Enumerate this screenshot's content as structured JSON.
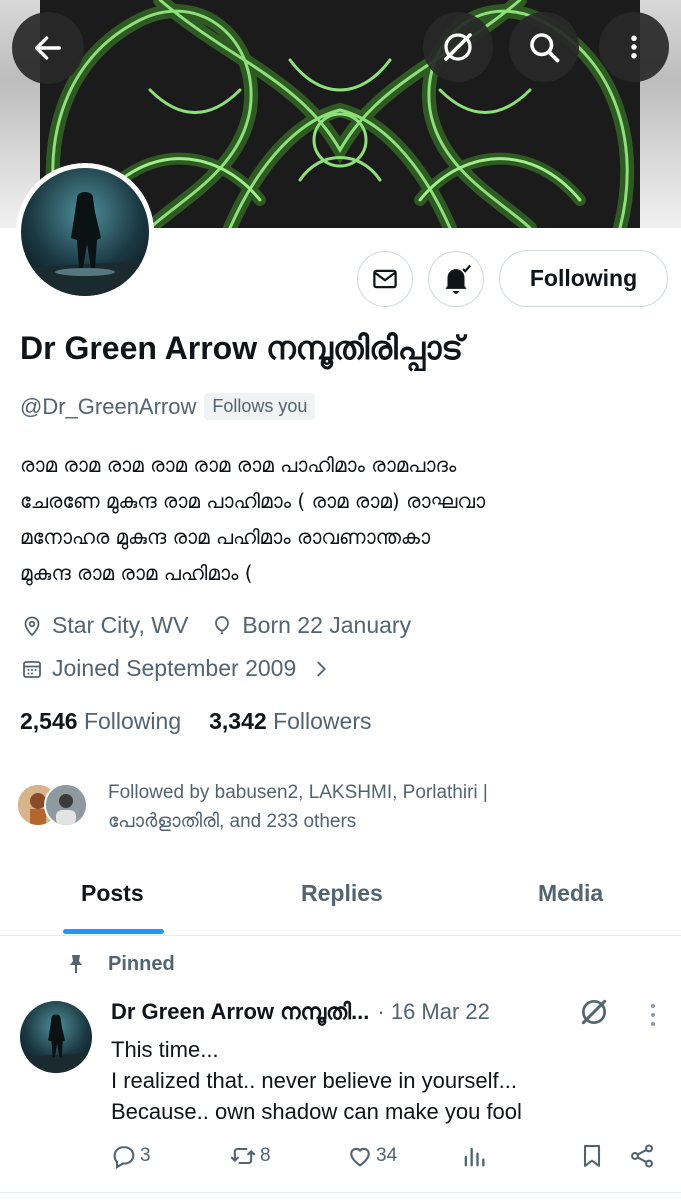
{
  "header": {
    "back_icon": "arrow-left-icon",
    "grok_icon": "slash-circle-icon",
    "search_icon": "search-icon",
    "more_icon": "vertical-dots-icon"
  },
  "profile": {
    "name": "Dr Green Arrow നമ്പൂതിരിപ്പാട്",
    "handle": "@Dr_GreenArrow",
    "follows_you": "Follows you",
    "following_button": "Following",
    "bio_lines": [
      "രാമ രാമ രാമ രാമ രാമ രാമ പാഹിമാം  രാമപാദം",
      "ചേരണേ മുകുന്ദ രാമ പാഹിമാം ( രാമ രാമ)       രാഘവാ",
      "മനോഹര മുകുന്ദ രാമ പഹിമാം      രാവണാന്തകാ",
      "മുകുന്ദ രാമ രാമ പഹിമാം  ("
    ],
    "location": "Star City, WV",
    "birthday": "Born 22 January",
    "joined": "Joined September 2009",
    "following_count": "2,546",
    "following_label": "Following",
    "followers_count": "3,342",
    "followers_label": "Followers",
    "followed_by_line1": "Followed by babusen2, LAKSHMI, Porlathiri |",
    "followed_by_line2": "പോർളാതിരി, and 233 others"
  },
  "tabs": [
    {
      "label": "Posts",
      "active": true
    },
    {
      "label": "Replies",
      "active": false
    },
    {
      "label": "Media",
      "active": false
    }
  ],
  "pinned_tweet": {
    "pinned_label": "Pinned",
    "author": "Dr Green Arrow നമ്പൂതി...",
    "date": "· 16 Mar 22",
    "text_lines": [
      "This time...",
      "I realized that.. never believe in yourself...",
      "Because.. own shadow can make you fool"
    ],
    "replies": "3",
    "reposts": "8",
    "likes": "34"
  },
  "colors": {
    "accent": "#1d9bf0",
    "text_primary": "#0f1419",
    "text_secondary": "#536471",
    "border": "#cfd9de"
  }
}
